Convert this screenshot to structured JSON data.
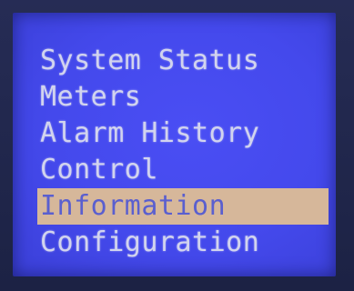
{
  "menu": {
    "items": [
      {
        "label": "System Status",
        "selected": false
      },
      {
        "label": "Meters",
        "selected": false
      },
      {
        "label": "Alarm History",
        "selected": false
      },
      {
        "label": "Control",
        "selected": false
      },
      {
        "label": "Information",
        "selected": true
      },
      {
        "label": "Configuration",
        "selected": false
      }
    ]
  },
  "colors": {
    "screen_background": "#4449ec",
    "text": "#d2d4ee",
    "highlight_background": "#d6b79a",
    "highlight_text": "#5a5fcf"
  }
}
